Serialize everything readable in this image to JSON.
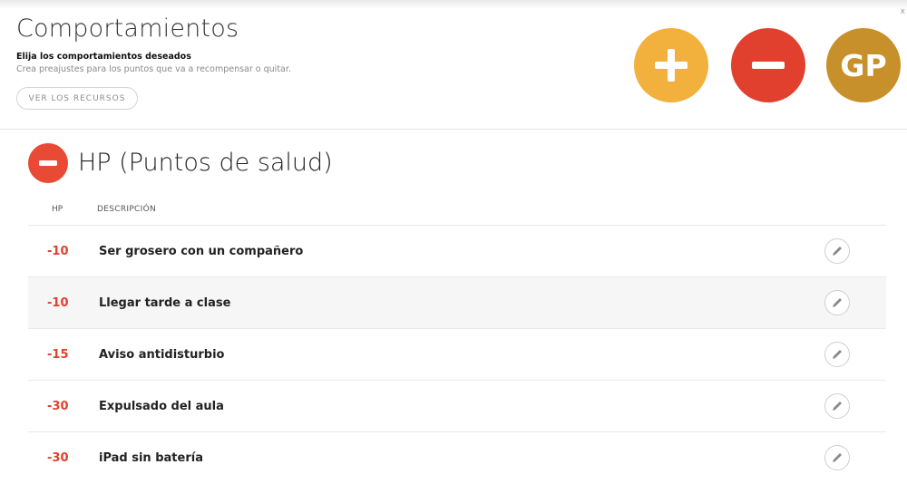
{
  "header": {
    "title": "Comportamientos",
    "subtitle": "Elija los comportamientos deseados",
    "description": "Crea preajustes para los puntos que va a recompensar o quitar.",
    "resources_button": "VER LOS RECURSOS",
    "gp_label": "GP",
    "corner_mark": "x"
  },
  "section": {
    "title": "HP (Puntos de salud)"
  },
  "table": {
    "col_hp": "HP",
    "col_desc": "DESCRIPCIÓN",
    "rows": [
      {
        "value": "-10",
        "label": "Ser grosero con un compañero"
      },
      {
        "value": "-10",
        "label": "Llegar tarde a clase"
      },
      {
        "value": "-15",
        "label": "Aviso antidisturbio"
      },
      {
        "value": "-30",
        "label": "Expulsado del aula"
      },
      {
        "value": "-30",
        "label": "iPad sin batería"
      }
    ]
  },
  "colors": {
    "plus": "#f2b03c",
    "minus": "#e0402d",
    "gp": "#c8902a",
    "negative_value": "#e0402d"
  },
  "icons": {
    "add": "plus-icon",
    "remove": "minus-icon",
    "edit": "pencil-icon"
  }
}
